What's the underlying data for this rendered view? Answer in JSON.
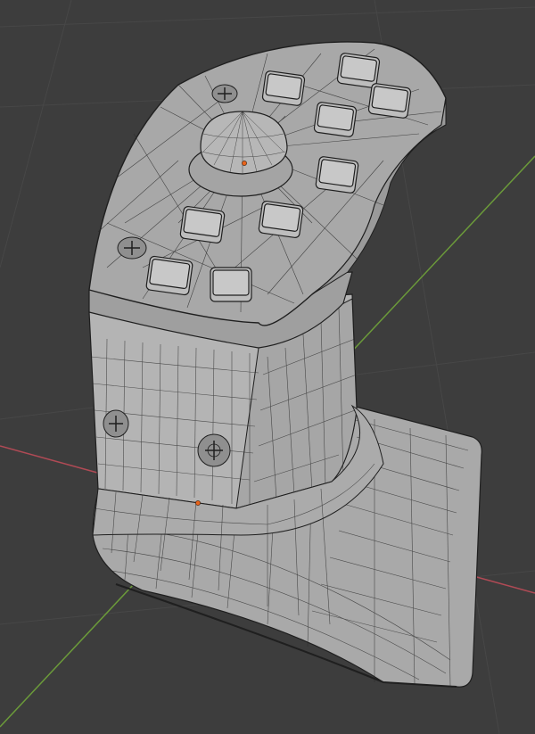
{
  "viewport": {
    "background": "#3d3d3d",
    "grid_color": "#474747",
    "x_axis_color": "#b04a55",
    "y_axis_color": "#6b9a3a"
  },
  "object": {
    "body_color": "#b2b2b2",
    "top_color": "#a7a7a7",
    "key_color": "#bdbdbd",
    "wire_color": "#2a2a2a",
    "origin_color": "#e8641c"
  }
}
